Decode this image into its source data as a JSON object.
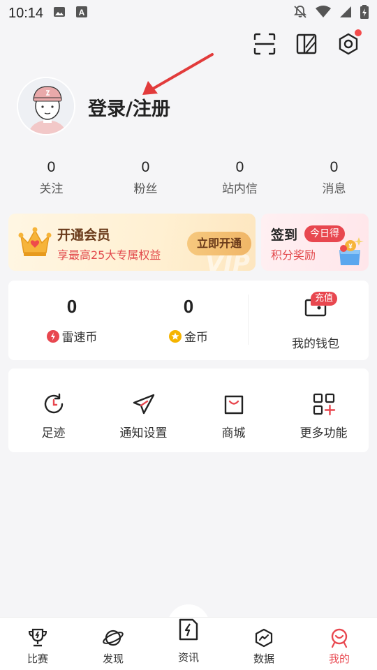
{
  "status_bar": {
    "time": "10:14"
  },
  "profile": {
    "login_label": "登录/注册"
  },
  "stats": [
    {
      "value": "0",
      "label": "关注"
    },
    {
      "value": "0",
      "label": "粉丝"
    },
    {
      "value": "0",
      "label": "站内信"
    },
    {
      "value": "0",
      "label": "消息"
    }
  ],
  "vip": {
    "title": "开通会员",
    "subtitle": "享最高25大专属权益",
    "button": "立即开通",
    "watermark": "VIP"
  },
  "sign_in": {
    "title": "签到",
    "badge": "今日得",
    "subtitle": "积分奖励"
  },
  "wallet": {
    "speed_coin": {
      "value": "0",
      "label": "雷速币"
    },
    "gold_coin": {
      "value": "0",
      "label": "金币"
    },
    "my_wallet": {
      "label": "我的钱包",
      "badge": "充值"
    }
  },
  "functions": [
    {
      "label": "足迹"
    },
    {
      "label": "通知设置"
    },
    {
      "label": "商城"
    },
    {
      "label": "更多功能"
    }
  ],
  "tabs": [
    {
      "label": "比赛"
    },
    {
      "label": "发现"
    },
    {
      "label": "资讯"
    },
    {
      "label": "数据"
    },
    {
      "label": "我的"
    }
  ],
  "colors": {
    "accent": "#e8474f",
    "background": "#f5f5f7",
    "vip_text": "#6a3a1a"
  }
}
